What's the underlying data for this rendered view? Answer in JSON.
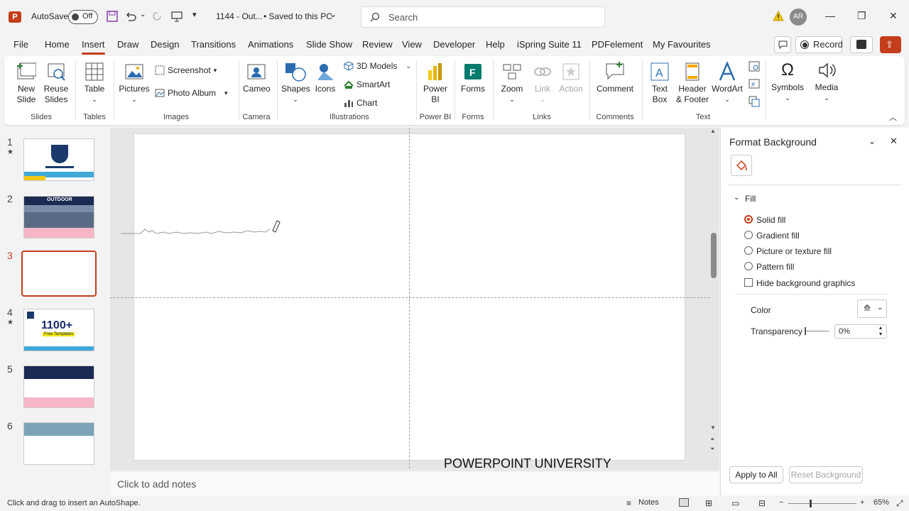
{
  "titlebar": {
    "autosave_label": "AutoSave",
    "autosave_state": "Off",
    "file_name": "1144 - Out...",
    "saved_status": "• Saved to this PC",
    "search_placeholder": "Search",
    "user_initials": "AR"
  },
  "menu": {
    "tabs": [
      "File",
      "Home",
      "Insert",
      "Draw",
      "Design",
      "Transitions",
      "Animations",
      "Slide Show",
      "Review",
      "View",
      "Developer",
      "Help",
      "iSpring Suite 11",
      "PDFelement",
      "My Favourites"
    ],
    "active_tab": "Insert",
    "record_label": "Record"
  },
  "ribbon": {
    "new_slide": "New Slide",
    "reuse_slides": "Reuse Slides",
    "table": "Table",
    "pictures": "Pictures",
    "screenshot": "Screenshot",
    "photo_album": "Photo Album",
    "cameo": "Cameo",
    "shapes": "Shapes",
    "icons": "Icons",
    "3d_models": "3D Models",
    "smartart": "SmartArt",
    "chart": "Chart",
    "power_bi": "Power BI",
    "forms": "Forms",
    "zoom": "Zoom",
    "link": "Link",
    "action": "Action",
    "comment": "Comment",
    "text_box": "Text Box",
    "header_footer": "Header & Footer",
    "wordart": "WordArt",
    "symbols": "Symbols",
    "media": "Media",
    "groups": {
      "slides": "Slides",
      "tables": "Tables",
      "images": "Images",
      "camera": "Camera",
      "illustrations": "Illustrations",
      "power_bi": "Power BI",
      "forms": "Forms",
      "links": "Links",
      "comments": "Comments",
      "text": "Text"
    }
  },
  "thumbnails": {
    "numbers": [
      "1",
      "2",
      "3",
      "4",
      "5",
      "6"
    ],
    "slide2_text": "OUTDOOR",
    "slide4_big": "1100+",
    "slide4_sub": "Free Templates",
    "selected": "3"
  },
  "slide": {
    "footer_text": "POWERPOINT UNIVERSITY"
  },
  "notes": {
    "placeholder": "Click to add notes"
  },
  "pane": {
    "title": "Format Background",
    "section": "Fill",
    "options": [
      "Solid fill",
      "Gradient fill",
      "Picture or texture fill",
      "Pattern fill"
    ],
    "selected_option": "Solid fill",
    "hide_bg_graphics": "Hide background graphics",
    "color_label": "Color",
    "transparency_label": "Transparency",
    "transparency_value": "0%",
    "apply_all": "Apply to All",
    "reset_bg": "Reset Background"
  },
  "status": {
    "message": "Click and drag to insert an AutoShape.",
    "notes_label": "Notes",
    "zoom": "65%"
  },
  "colors": {
    "accent": "#c43e1c",
    "ribbon_bg": "#ffffff"
  }
}
